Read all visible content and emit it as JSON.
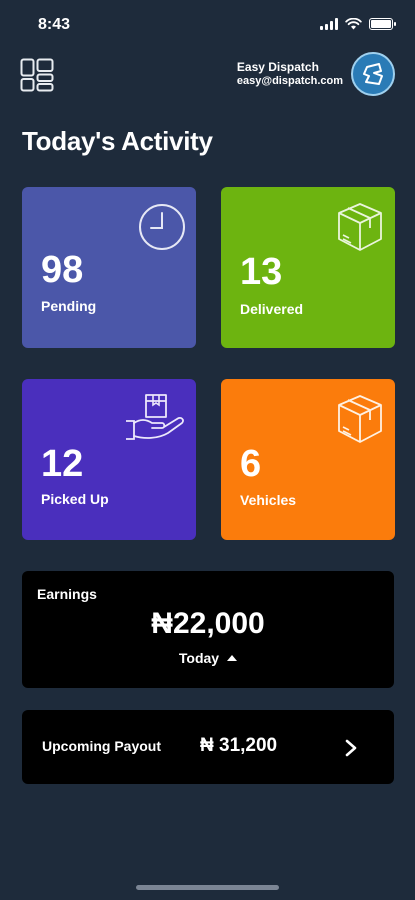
{
  "status_bar": {
    "time": "8:43"
  },
  "header": {
    "company_name": "Easy Dispatch",
    "email": "easy@dispatch.com"
  },
  "title": "Today's Activity",
  "tiles": [
    {
      "value": "98",
      "label": "Pending",
      "color": "#4b57a9",
      "icon": "clock-icon"
    },
    {
      "value": "13",
      "label": "Delivered",
      "color": "#6db410",
      "icon": "box-icon"
    },
    {
      "value": "12",
      "label": "Picked Up",
      "color": "#4a2fbd",
      "icon": "hand-box-icon"
    },
    {
      "value": "6",
      "label": "Vehicles",
      "color": "#fb7c0c",
      "icon": "box-icon"
    }
  ],
  "earnings": {
    "label": "Earnings",
    "amount": "₦22,000",
    "period": "Today"
  },
  "payout": {
    "label": "Upcoming Payout",
    "amount": "₦ 31,200"
  },
  "colors": {
    "background": "#1e2b3b",
    "card": "#000000"
  }
}
